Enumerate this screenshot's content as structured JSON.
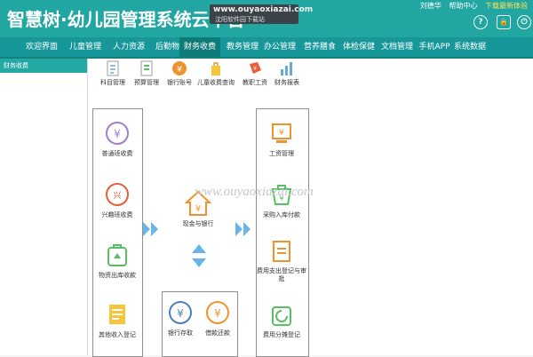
{
  "header": {
    "logo_text": "智慧树·幼儿园管理系统云平台",
    "watermark_site": "www.ouyaoxiazai.com",
    "watermark_sub": "沈阳软件园下载站",
    "user_name": "刘德华",
    "help_center": "帮助中心",
    "download_link": "下载最新体验"
  },
  "nav": {
    "tabs": [
      "欢迎界面",
      "儿童管理",
      "人力资源",
      "后勤物资",
      "财务收费",
      "教务管理",
      "办公管理",
      "营养膳食",
      "体检保健",
      "文档管理",
      "手机APP",
      "系统数据"
    ],
    "active_index": 4
  },
  "sidebar": {
    "title": "财务收费"
  },
  "top_functions": [
    {
      "label": "科目管理",
      "icon": "ledger-icon"
    },
    {
      "label": "预算管理",
      "icon": "document-icon"
    },
    {
      "label": "银行账号",
      "icon": "coin-icon"
    },
    {
      "label": "儿童收费查询",
      "icon": "bag-icon"
    },
    {
      "label": "教职工资",
      "icon": "money-tag-icon"
    },
    {
      "label": "财务报表",
      "icon": "chart-icon"
    }
  ],
  "left_box": [
    {
      "label": "普通班收费",
      "icon": "yuan-circle-icon"
    },
    {
      "label": "兴趣班收费",
      "icon": "interest-circle-icon"
    },
    {
      "label": "物资出库收款",
      "icon": "inventory-bag-icon"
    },
    {
      "label": "其他收入登记",
      "icon": "income-note-icon"
    }
  ],
  "center": {
    "label": "现金与银行",
    "icon": "cash-house-icon"
  },
  "bottom_box": [
    {
      "label": "银行存取",
      "icon": "bank-transfer-icon"
    },
    {
      "label": "借款还款",
      "icon": "loan-repay-icon"
    }
  ],
  "right_box": [
    {
      "label": "工资管理",
      "icon": "salary-icon"
    },
    {
      "label": "采购入库付款",
      "icon": "purchase-icon"
    },
    {
      "label": "费用支出登记与审批",
      "icon": "expense-approval-icon"
    },
    {
      "label": "费用分摊登记",
      "icon": "allocation-icon"
    }
  ],
  "watermark_mid": "www.ouyaoxiazai.com",
  "colors": {
    "brand": "#21a6a1",
    "nav": "#17979a",
    "arrow": "#69b5e6",
    "orange": "#f0932f",
    "yellow": "#f5c63c",
    "green": "#58c062"
  }
}
